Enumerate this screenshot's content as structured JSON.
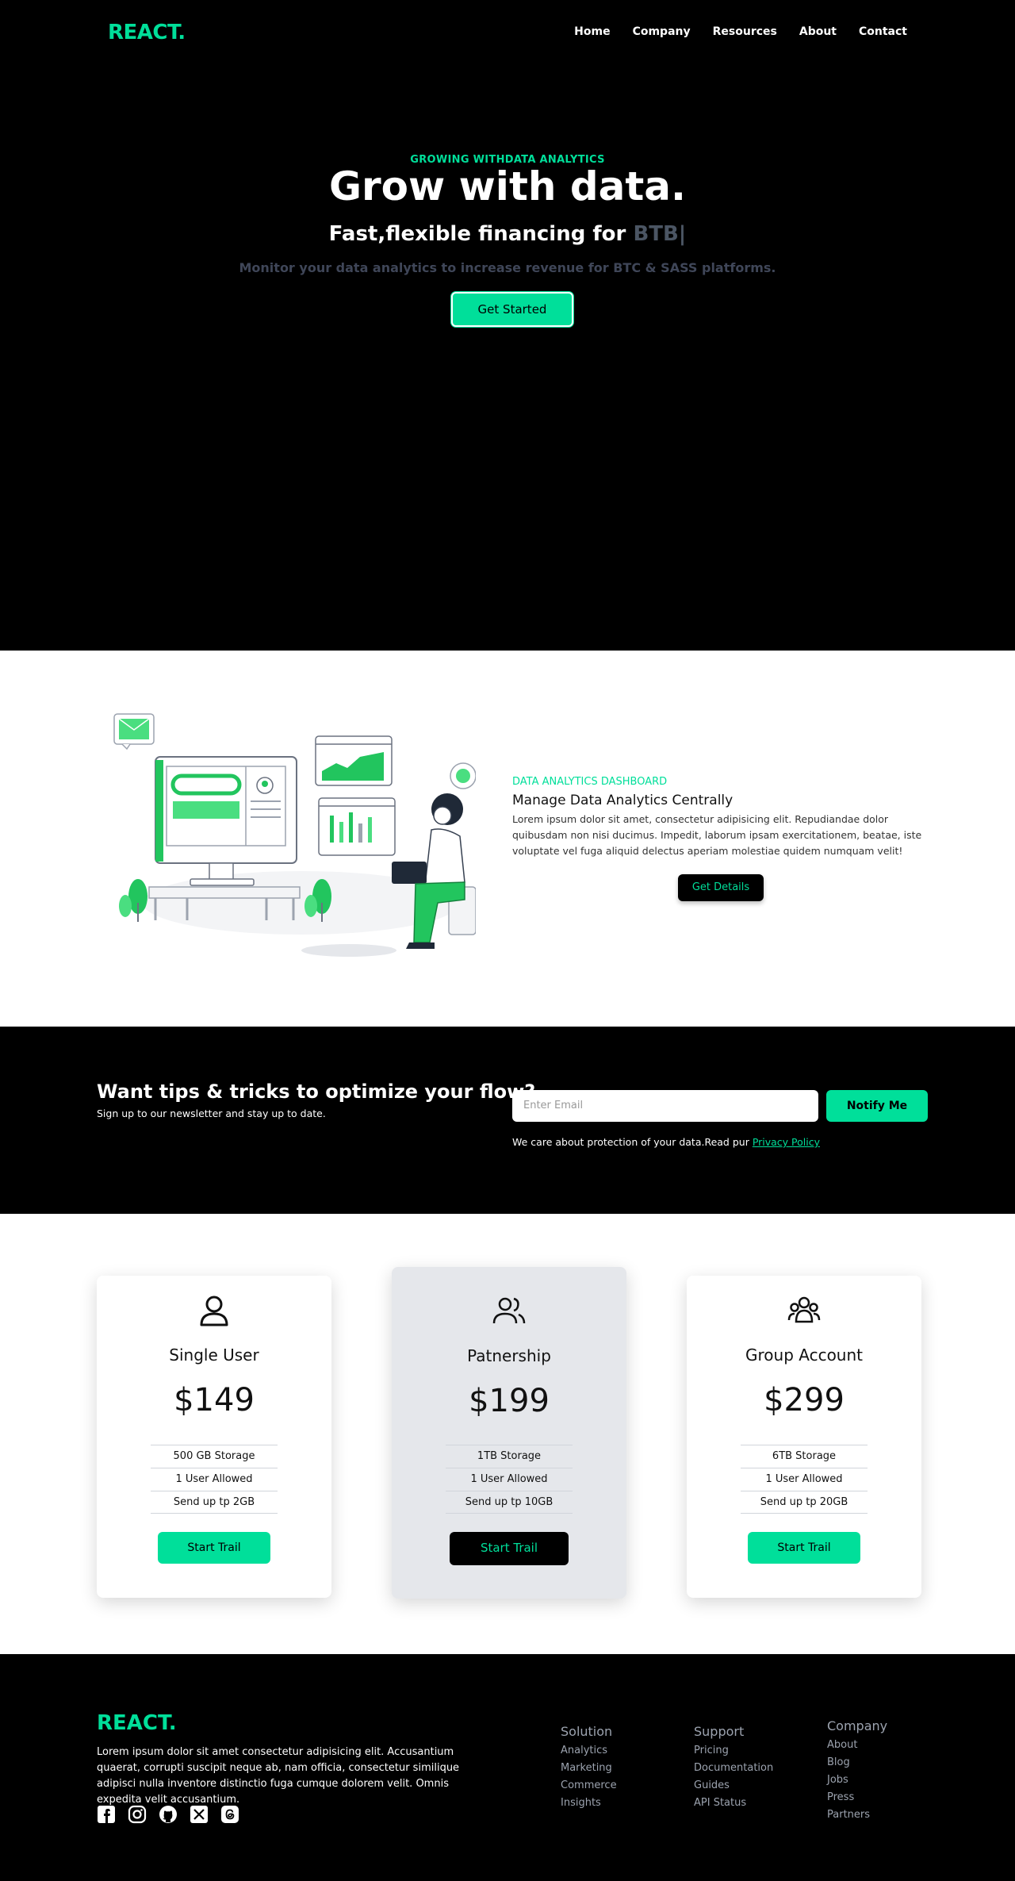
{
  "nav": {
    "logo": "REACT.",
    "links": [
      "Home",
      "Company",
      "Resources",
      "About",
      "Contact"
    ]
  },
  "hero": {
    "eyebrow": "GROWING WITHDATA ANALYTICS",
    "title": "Grow with data.",
    "subtitle_prefix": "Fast,flexible financing for",
    "typed_word": "BTB|",
    "description": "Monitor your data analytics to increase revenue for BTC & SASS platforms.",
    "cta": "Get Started"
  },
  "analytics": {
    "eyebrow": "DATA ANALYTICS DASHBOARD",
    "title": "Manage Data Analytics Centrally",
    "body": "Lorem ipsum dolor sit amet, consectetur adipisicing elit. Repudiandae dolor quibusdam non nisi ducimus. Impedit, laborum ipsam exercitationem, beatae, iste voluptate vel fuga aliquid delectus aperiam molestiae quidem numquam velit!",
    "button": "Get Details"
  },
  "newsletter": {
    "title": "Want tips & tricks to optimize your flow?",
    "subtitle": "Sign up to our newsletter and stay up to date.",
    "email_placeholder": "Enter Email",
    "button": "Notify Me",
    "privacy_text": "We care about protection of your data.Read pur",
    "privacy_link": "Privacy Policy"
  },
  "pricing": {
    "plans": [
      {
        "name": "Single User",
        "icon": "user-icon",
        "price": "$149",
        "features": [
          "500 GB Storage",
          "1 User Allowed",
          "Send up tp 2GB"
        ],
        "button": "Start Trail"
      },
      {
        "name": "Patnership",
        "icon": "users-icon",
        "price": "$199",
        "features": [
          "1TB Storage",
          "1 User Allowed",
          "Send up tp 10GB"
        ],
        "button": "Start Trail"
      },
      {
        "name": "Group Account",
        "icon": "group-icon",
        "price": "$299",
        "features": [
          "6TB Storage",
          "1 User Allowed",
          "Send up tp 20GB"
        ],
        "button": "Start Trail"
      }
    ]
  },
  "footer": {
    "logo": "REACT.",
    "text": "Lorem ipsum dolor sit amet consectetur adipisicing elit. Accusantium quaerat, corrupti suscipit neque ab, nam officia, consectetur similique adipisci nulla inventore distinctio fuga cumque dolorem velit. Omnis expedita velit accusantium.",
    "socials": [
      "facebook-icon",
      "instagram-icon",
      "github-icon",
      "x-icon",
      "threads-icon"
    ],
    "columns": [
      {
        "heading": "Solution",
        "links": [
          "Analytics",
          "Marketing",
          "Commerce",
          "Insights"
        ]
      },
      {
        "heading": "Support",
        "links": [
          "Pricing",
          "Documentation",
          "Guides",
          "API Status"
        ]
      },
      {
        "heading": "Company",
        "links": [
          "About",
          "Blog",
          "Jobs",
          "Press",
          "Partners"
        ]
      }
    ]
  },
  "colors": {
    "accent": "#00df9a",
    "dark": "#000000",
    "muted": "#9ca3af"
  }
}
